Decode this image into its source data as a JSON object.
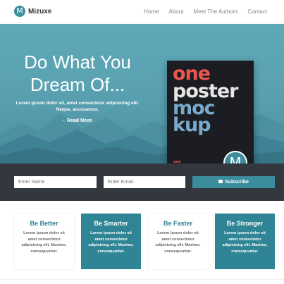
{
  "brand": {
    "logo_letter": "M",
    "name": "Mizuxe"
  },
  "nav": {
    "items": [
      {
        "label": "Home"
      },
      {
        "label": "About"
      },
      {
        "label": "Meet The Authors"
      },
      {
        "label": "Contact"
      }
    ]
  },
  "hero": {
    "title": "Do What You Dream Of...",
    "subtitle": "Lorem ipsum dolor sit, amet consectetur adipisicing elit. Neque, accusamus.",
    "read_more": "Read More",
    "read_more_arrow": "→"
  },
  "poster": {
    "lines": [
      "one",
      "poster",
      "moc",
      "kup"
    ],
    "logo_letter": "M"
  },
  "subscribe": {
    "name_placeholder": "Enter Name",
    "email_placeholder": "Enter Email",
    "button_label": "Subscribe"
  },
  "features": [
    {
      "title": "Be Better",
      "text": "Lorem ipsum dolor sit amet consectetur adipisicing elit. Maxime, consequuntur.",
      "style": "light"
    },
    {
      "title": "Be Smarter",
      "text": "Lorem ipsum dolor sit amet consectetur adipisicing elit. Maxime, consequuntur.",
      "style": "dark"
    },
    {
      "title": "Be Faster",
      "text": "Lorem ipsum dolor sit amet consectetur adipisicing elit. Maxime, consequuntur.",
      "style": "light"
    },
    {
      "title": "Be Stronger",
      "text": "Lorem ipsum dolor sit amet consectetur adipisicing elit. Maxime, consequuntur.",
      "style": "dark"
    }
  ],
  "colors": {
    "accent": "#3b8c9c",
    "dark_bar": "#33383e",
    "card_dark": "#2f8595"
  }
}
